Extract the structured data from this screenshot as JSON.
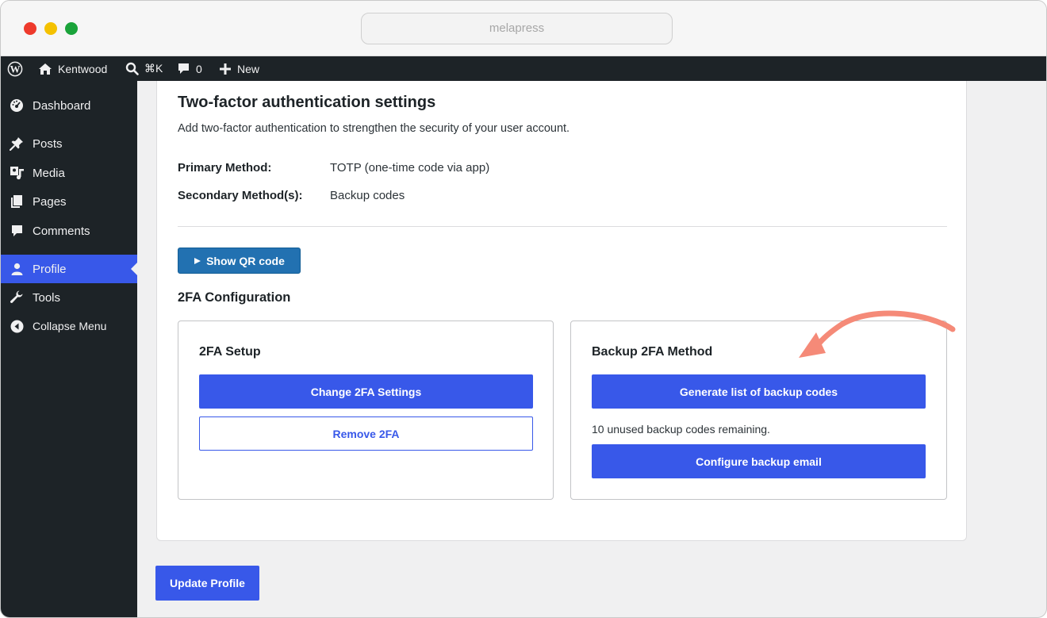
{
  "browser": {
    "url_text": "melapress"
  },
  "admin_bar": {
    "site_name": "Kentwood",
    "search_shortcut": "⌘K",
    "comments_count": "0",
    "new_label": "New",
    "wp_logo_icon": "wordpress-icon",
    "home_icon": "home-icon",
    "search_icon": "search-icon",
    "comment_icon": "comment-icon",
    "plus_icon": "plus-icon"
  },
  "sidebar": {
    "items": [
      {
        "label": "Dashboard",
        "icon": "dashboard-icon"
      },
      {
        "label": "Posts",
        "icon": "pushpin-icon"
      },
      {
        "label": "Media",
        "icon": "media-icon"
      },
      {
        "label": "Pages",
        "icon": "pages-icon"
      },
      {
        "label": "Comments",
        "icon": "comments-icon"
      },
      {
        "label": "Profile",
        "icon": "user-icon",
        "active": true
      },
      {
        "label": "Tools",
        "icon": "wrench-icon"
      },
      {
        "label": "Collapse Menu",
        "icon": "collapse-icon"
      }
    ]
  },
  "settings": {
    "title": "Two-factor authentication settings",
    "description": "Add two-factor authentication to strengthen the security of your user account.",
    "primary_label": "Primary Method:",
    "primary_value": "TOTP (one-time code via app)",
    "secondary_label": "Secondary Method(s):",
    "secondary_value": "Backup codes",
    "qr_button": "Show QR code",
    "config_title": "2FA Configuration"
  },
  "setup_panel": {
    "title": "2FA Setup",
    "change_button": "Change 2FA Settings",
    "remove_button": "Remove 2FA"
  },
  "backup_panel": {
    "title": "Backup 2FA Method",
    "generate_button": "Generate list of backup codes",
    "remaining_text": "10 unused backup codes remaining.",
    "email_button": "Configure backup email"
  },
  "footer": {
    "update_button": "Update Profile"
  },
  "colors": {
    "accent": "#3858e9",
    "admin_bar": "#1d2327",
    "qr_button": "#2271b1",
    "annotation_arrow": "#f58a78"
  }
}
